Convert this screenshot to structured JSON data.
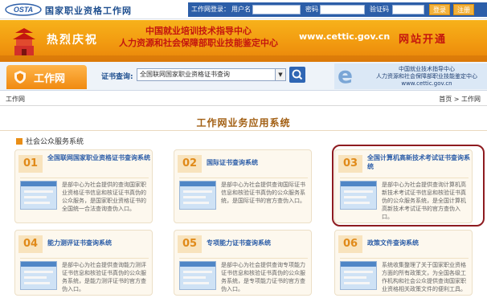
{
  "header": {
    "site_title": "国家职业资格工作网",
    "login_label": "工作网登录：",
    "username_label": "用户名",
    "password_label": "密码",
    "captcha_label": "验证码",
    "login_button": "登录",
    "register_button": "注册"
  },
  "banner": {
    "left_text": "热烈庆祝",
    "center_line1": "中国就业培训技术指导中心",
    "center_line2": "人力资源和社会保障部职业技能鉴定中心",
    "url": "www.cettic.gov.cn",
    "right_text": "网站开通"
  },
  "nav": {
    "work_tab": "工作网",
    "search_label": "证书查询:",
    "search_select_value": "全国联网国家职业资格证书查询",
    "promo_line1": "中国就业技术指导中心",
    "promo_line2": "人力资源和社会保障部职业技能鉴定中心",
    "promo_url": "www.cettic.gov.cn"
  },
  "breadcrumb": {
    "left": "工作网",
    "right": "首页 > 工作网"
  },
  "main_title": "工作网业务应用系统",
  "section_title": "社会公众服务系统",
  "cards": [
    {
      "num": "01",
      "title": "全国联网国家职业资格证书查询系统",
      "desc": "是部中心为社会提供的查询国家职业资格证书信息和核证证书真伪的公众服务，是国家职业资格证书的全国统一合法查询查伪入口。"
    },
    {
      "num": "02",
      "title": "国际证书查询系统",
      "desc": "是部中心为社会提供查询国际证书信息和核验证书真伪的公众服务系统，是国际证书的官方查伪入口。"
    },
    {
      "num": "03",
      "title": "全国计算机高新技术考试证书查询系统",
      "desc": "是部中心为社会提供查询计算机高新技术考试证书信息和核验证书真伪的公众服务系统，是全国计算机高新技术考试证书的官方查伪入口。"
    },
    {
      "num": "04",
      "title": "能力测评证书查询系统",
      "desc": "是部中心为社会提供查询能力测评证书信息和核验证书真伪的公众服务系统，是能力测评证书的官方查伪入口。"
    },
    {
      "num": "05",
      "title": "专项能力证书查询系统",
      "desc": "是部中心为社会提供查询专项能力证书信息和核验证书真伪的公众服务系统，是专项能力证书的官方查伪入口。"
    },
    {
      "num": "06",
      "title": "政策文件查询系统",
      "desc": "系统收集整理了关于国家职业资格方面的所有政策文，为全国各级工作机构和社会公众提供查询国家职业资格相关政策文件的便利工具。"
    }
  ]
}
